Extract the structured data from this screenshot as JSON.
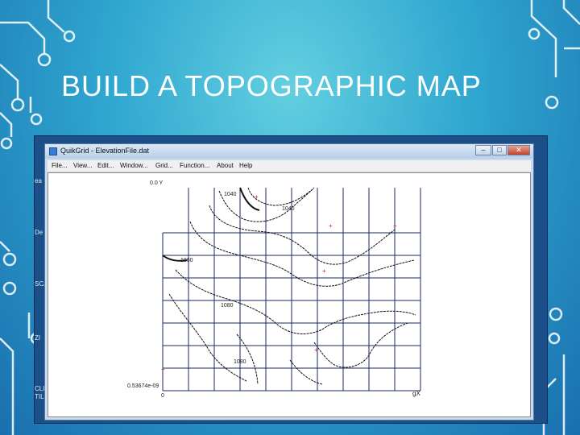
{
  "slide": {
    "title": "BUILD A TOPOGRAPHIC MAP"
  },
  "background_colors": {
    "top": "#63cfe0",
    "bottom": "#1a6fae",
    "circuit_lines": "#ffffff"
  },
  "desktop": {
    "top_crumb": "...",
    "side_glyphs": [
      "ea",
      "De",
      "SCA",
      "ZI",
      "CLI",
      "TIL"
    ]
  },
  "window": {
    "title": "QuikGrid - ElevationFile.dat",
    "controls": {
      "minimize": "–",
      "maximize": "□",
      "close": "✕"
    },
    "menu": [
      "File...",
      "View...",
      "Edit...",
      "Window...",
      "Grid...",
      "Function...",
      "About",
      "Help"
    ]
  },
  "plot": {
    "top_axis_label": "0.0 Y",
    "bottom_left_value": "0.53674e-09",
    "bottom_origin": "0",
    "x_axis_label": "gX",
    "contour_labels": [
      "1040",
      "1040",
      "1060",
      "1080",
      "1080"
    ],
    "point_marker": "+"
  }
}
